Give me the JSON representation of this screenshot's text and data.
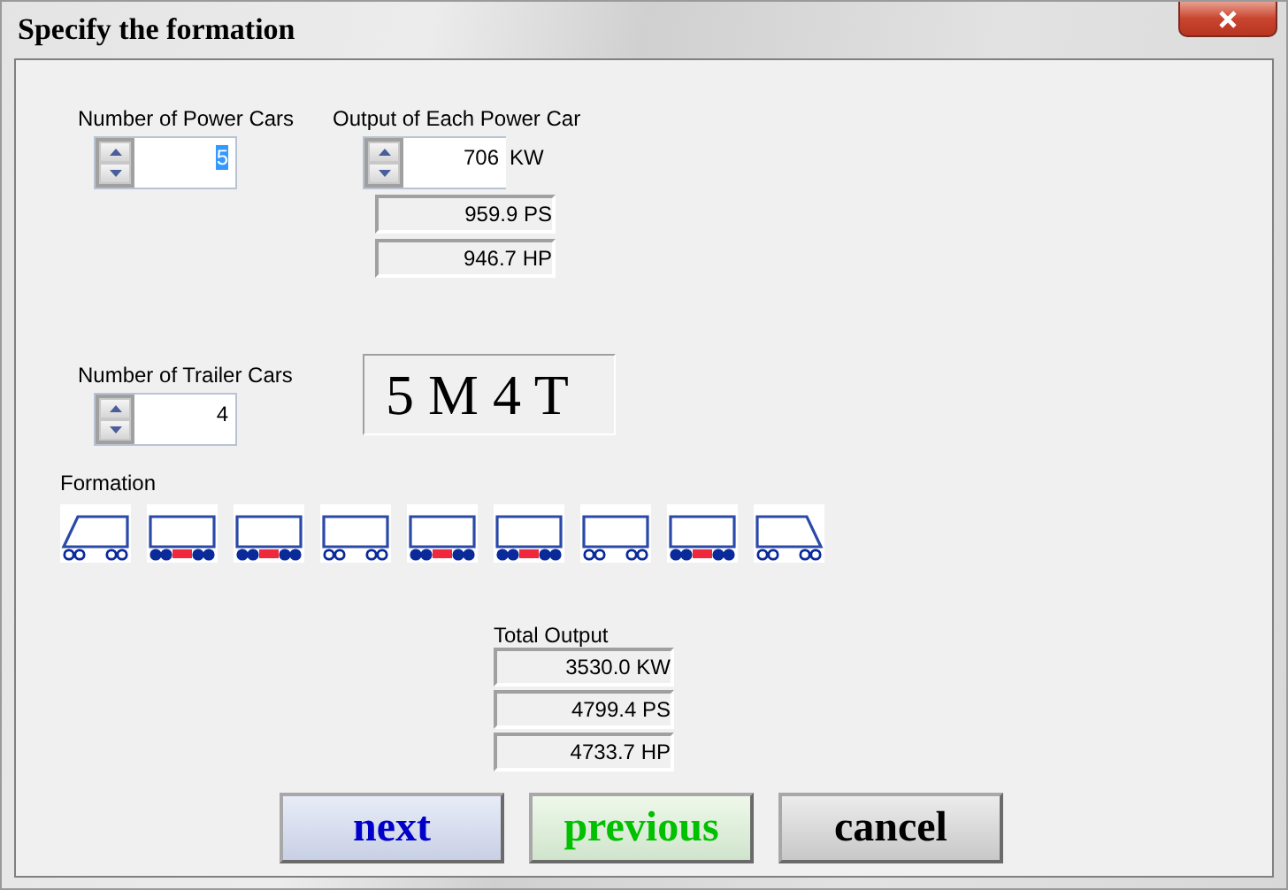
{
  "window": {
    "title": "Specify the formation"
  },
  "power_cars": {
    "label": "Number of Power Cars",
    "value": "5",
    "text_selected": true
  },
  "output_each": {
    "label": "Output of Each Power Car",
    "value": "706",
    "unit": "KW",
    "readouts": [
      "959.9 PS",
      "946.7 HP"
    ]
  },
  "trailer_cars": {
    "label": "Number of Trailer Cars",
    "value": "4",
    "text_selected": false
  },
  "summary": "5 M 4 T",
  "formation": {
    "label": "Formation",
    "cars": [
      {
        "kind": "cab-left"
      },
      {
        "kind": "motor"
      },
      {
        "kind": "motor"
      },
      {
        "kind": "trailer"
      },
      {
        "kind": "motor"
      },
      {
        "kind": "motor"
      },
      {
        "kind": "trailer"
      },
      {
        "kind": "motor"
      },
      {
        "kind": "cab-right"
      }
    ]
  },
  "total_output": {
    "label": "Total Output",
    "readouts": [
      "3530.0 KW",
      "4799.4 PS",
      "4733.7 HP"
    ]
  },
  "buttons": [
    {
      "label": "next",
      "color": "#0000c8"
    },
    {
      "label": "previous",
      "color": "#00c000"
    },
    {
      "label": "cancel",
      "color": "#000000"
    }
  ]
}
